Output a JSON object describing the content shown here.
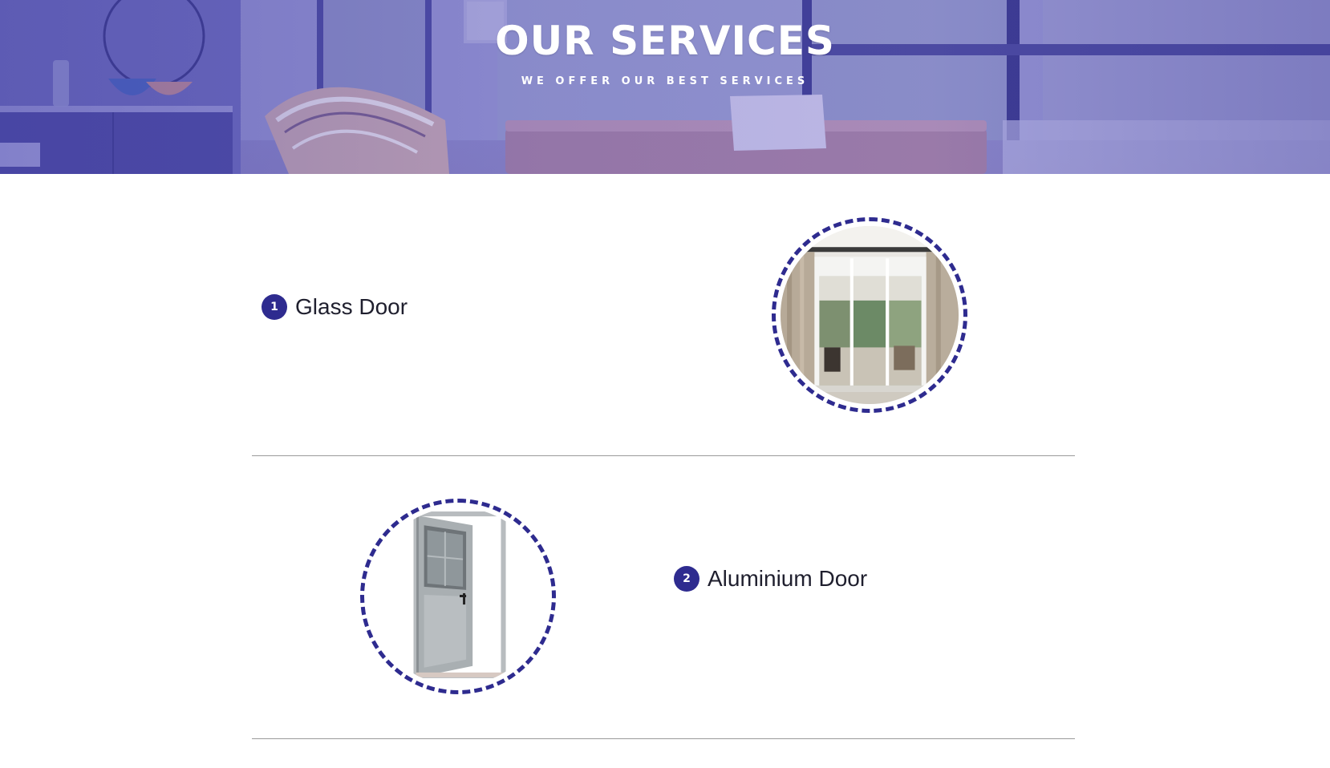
{
  "hero": {
    "title": "OUR SERVICES",
    "subtitle": "WE OFFER OUR BEST SERVICES"
  },
  "services": [
    {
      "number": "1",
      "name": "Glass Door",
      "image_icon": "sliding-glass-door-photo"
    },
    {
      "number": "2",
      "name": "Aluminium Door",
      "image_icon": "aluminium-door-photo"
    }
  ],
  "colors": {
    "accent": "#2e2b8f",
    "hero_tint": "#8583cc",
    "divider": "#9a9a9a",
    "text": "#1f1f2e"
  }
}
